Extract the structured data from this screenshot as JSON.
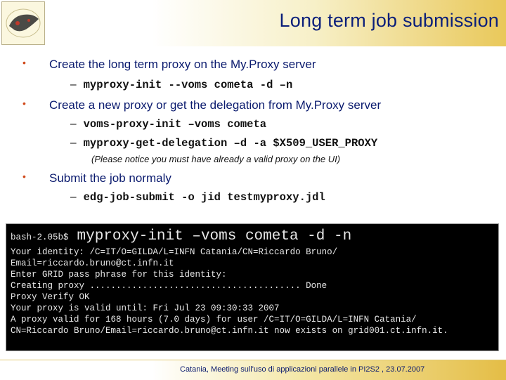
{
  "header": {
    "title": "Long term job submission",
    "logo_icon": "gilda-logo-icon"
  },
  "bullets": [
    {
      "text": "Create the long term proxy on the My.Proxy server",
      "subs": [
        "myproxy-init --voms cometa -d –n"
      ]
    },
    {
      "text": "Create a new proxy or get the delegation from My.Proxy server",
      "subs": [
        "voms-proxy-init –voms cometa",
        "myproxy-get-delegation –d -a $X509_USER_PROXY"
      ],
      "note": "(Please notice you must have already a valid proxy on the UI)"
    },
    {
      "text": "Submit the job normaly",
      "subs": [
        "edg-job-submit -o jid testmyproxy.jdl"
      ]
    }
  ],
  "terminal": {
    "prompt": "bash-2.05b$",
    "command": "myproxy-init –voms cometa -d -n",
    "output": [
      "Your identity: /C=IT/O=GILDA/L=INFN Catania/CN=Riccardo Bruno/",
      "Email=riccardo.bruno@ct.infn.it",
      "Enter GRID pass phrase for this identity:",
      "Creating proxy ........................................ Done",
      "Proxy Verify OK",
      "Your proxy is valid until: Fri Jul 23 09:30:33 2007",
      "A proxy valid for 168 hours (7.0 days) for user /C=IT/O=GILDA/L=INFN Catania/",
      "CN=Riccardo Bruno/Email=riccardo.bruno@ct.infn.it now exists on grid001.ct.infn.it."
    ]
  },
  "footer": {
    "text": "Catania, Meeting sull'uso di applicazioni parallele in PI2S2 , 23.07.2007"
  },
  "colors": {
    "title": "#0b1f7a",
    "bullet": "#d04a1c",
    "header_gold": "#e9c85a"
  }
}
